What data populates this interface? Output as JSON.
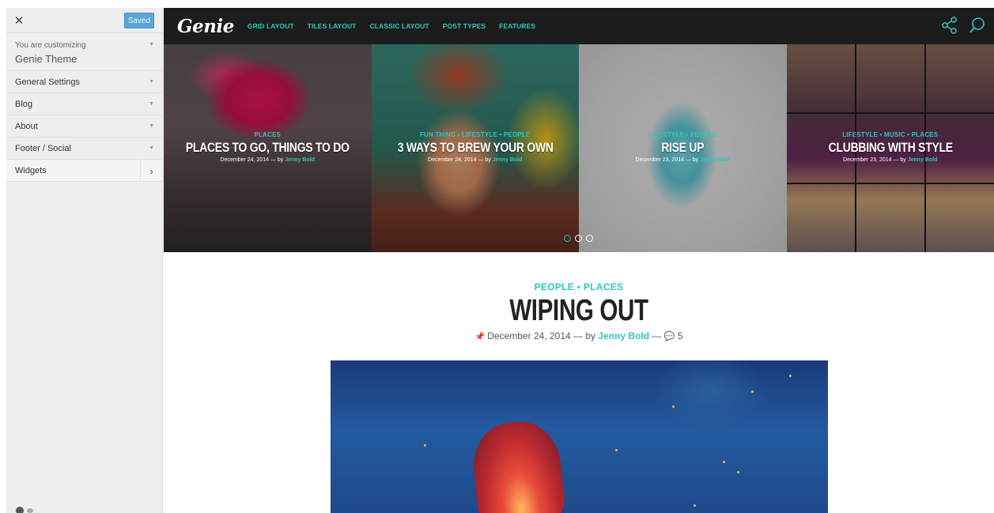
{
  "sidebar": {
    "close_icon": "close-icon",
    "saved_label": "Saved",
    "customizing_label": "You are customizing",
    "theme_name": "Genie Theme",
    "sections": [
      {
        "label": "General Settings"
      },
      {
        "label": "Blog"
      },
      {
        "label": "About"
      },
      {
        "label": "Footer / Social"
      },
      {
        "label": "Widgets"
      }
    ]
  },
  "nav": {
    "logo": "Genie",
    "items": [
      "GRID LAYOUT",
      "TILES LAYOUT",
      "CLASSIC LAYOUT",
      "POST TYPES",
      "FEATURES"
    ],
    "accent": "#2cc8c0"
  },
  "slides": [
    {
      "category": "PLACES",
      "title": "PLACES TO GO, THINGS TO DO",
      "date": "December 24, 2014 — by",
      "author": "Jenny Bold"
    },
    {
      "category": "FUN THING • LIFESTYLE • PEOPLE",
      "title": "3 WAYS TO BREW YOUR OWN",
      "date": "December 24, 2014 — by",
      "author": "Jenny Bold"
    },
    {
      "category": "LIFESTYLE • PEOPLE",
      "title": "RISE UP",
      "date": "December 23, 2014 — by",
      "author": "Jenny Bold"
    },
    {
      "category": "LIFESTYLE • MUSIC • PLACES",
      "title": "CLUBBING WITH STYLE",
      "date": "December 23, 2014 — by",
      "author": "Jenny Bold"
    }
  ],
  "post": {
    "categories": "PEOPLE • PLACES",
    "title": "WIPING OUT",
    "date": "December 24, 2014 — by",
    "author": "Jenny Bold",
    "separator": "—",
    "comments": "5"
  }
}
